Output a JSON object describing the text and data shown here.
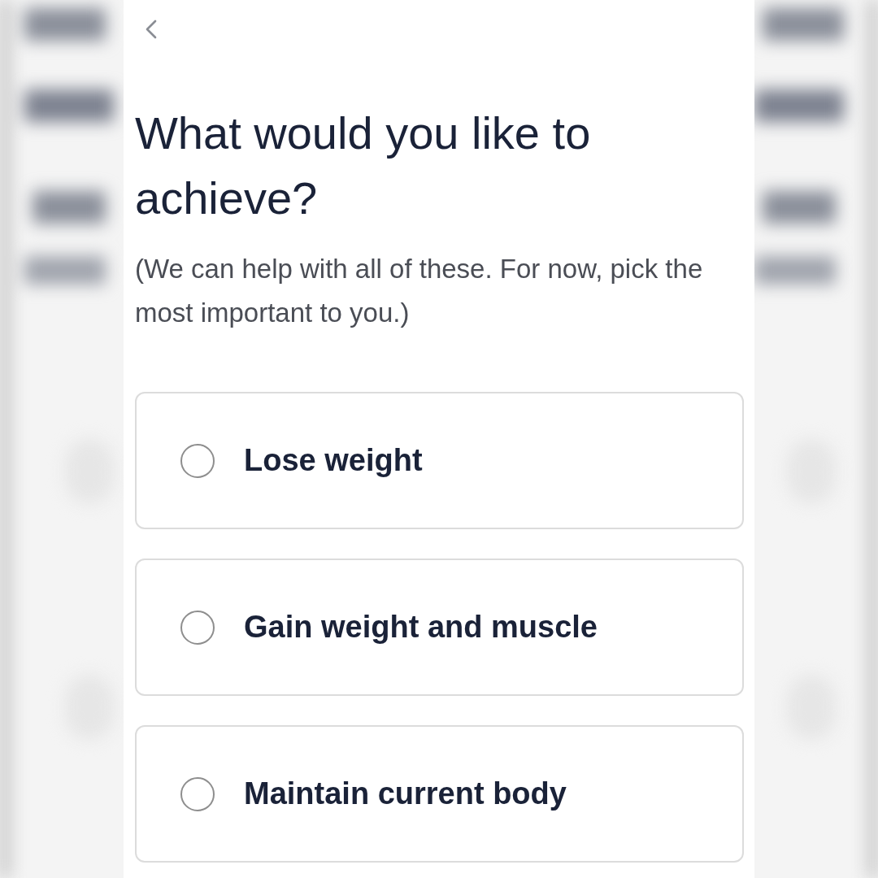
{
  "title": "What would you like to achieve?",
  "subtitle": "(We can help with all of these. For now, pick the most important to you.)",
  "options": [
    {
      "label": "Lose weight",
      "selected": false
    },
    {
      "label": "Gain weight and muscle",
      "selected": false
    },
    {
      "label": "Maintain current body",
      "selected": false
    }
  ]
}
